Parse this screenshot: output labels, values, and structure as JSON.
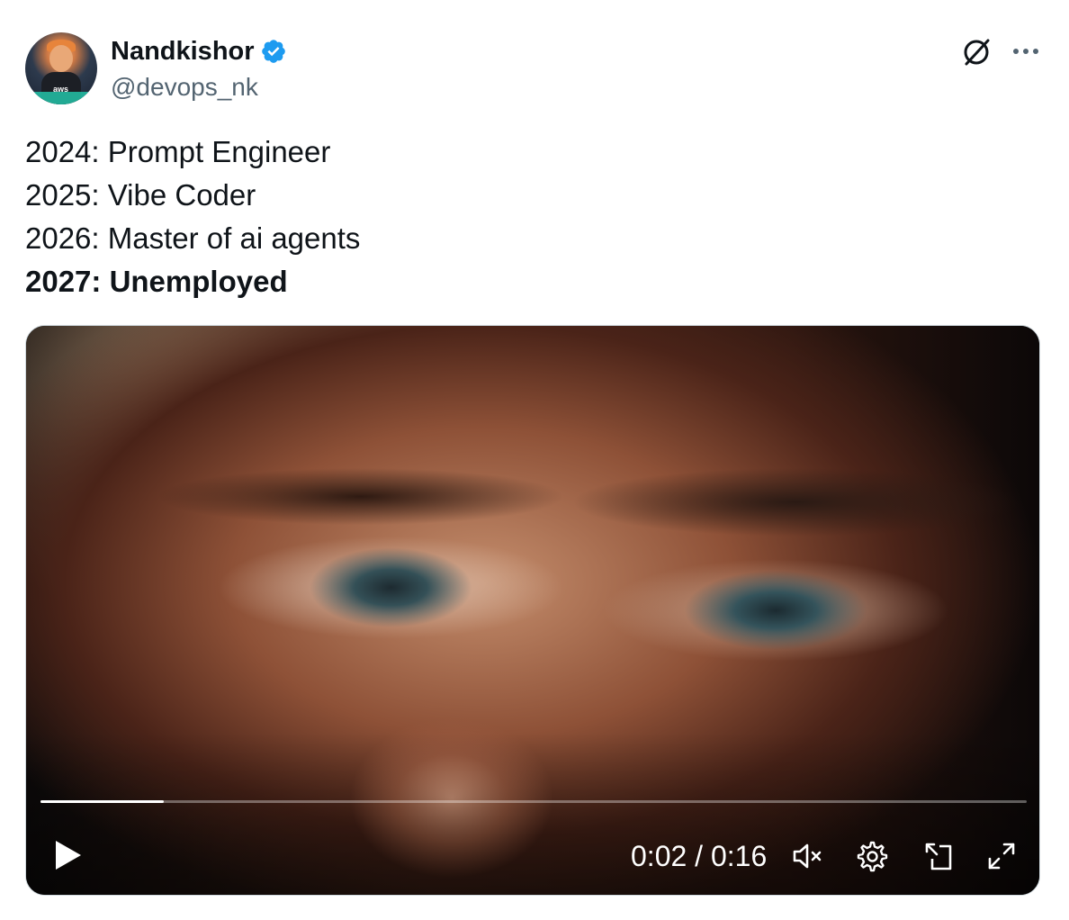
{
  "tweet": {
    "author": {
      "display_name": "Nandkishor",
      "handle": "@devops_nk",
      "verified": true,
      "avatar_text": "aws"
    },
    "icons": {
      "grok": "grok-icon",
      "more": "more-options-icon",
      "verified": "verified-badge-icon"
    },
    "lines": [
      "2024: Prompt Engineer",
      "2025: Vibe Coder",
      "2026: Master of ai agents",
      "2027: Unemployed"
    ],
    "bold_line_index": 3,
    "accent_color": "#1d9bf0",
    "handle_color": "#536471"
  },
  "video": {
    "current_time": "0:02",
    "duration": "0:16",
    "time_display": "0:02 / 0:16",
    "progress_fraction": 0.125,
    "muted": true,
    "icons": {
      "play": "play-icon",
      "mute": "volume-muted-icon",
      "settings": "settings-gear-icon",
      "pip": "picture-in-picture-icon",
      "fullscreen": "fullscreen-icon"
    }
  }
}
